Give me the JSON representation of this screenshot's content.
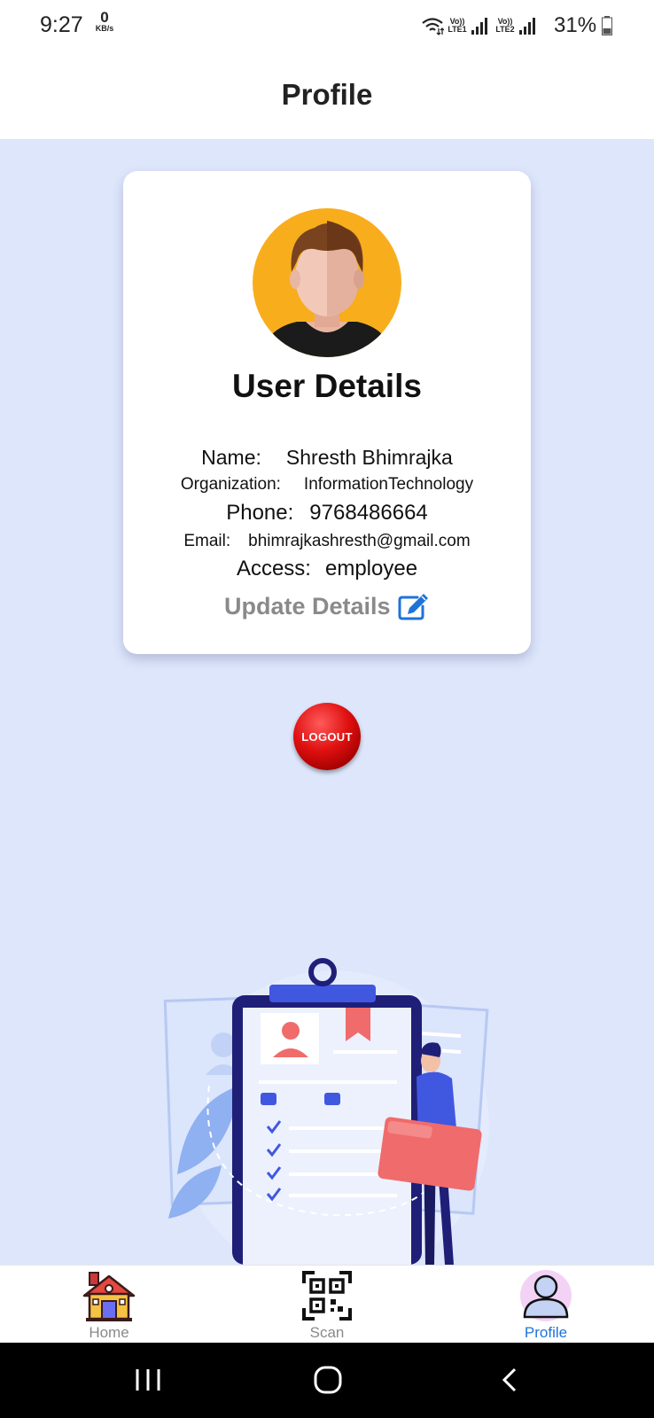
{
  "status_bar": {
    "time": "9:27",
    "net_speed_value": "0",
    "net_speed_unit": "KB/s",
    "sim1_label": "Vo)) LTE1",
    "sim2_label": "Vo)) LTE2",
    "battery_percent": "31%"
  },
  "header": {
    "title": "Profile"
  },
  "user_card": {
    "heading": "User Details",
    "name_label": "Name:",
    "name_value": "Shresth Bhimrajka",
    "organization_label": "Organization:",
    "organization_value": "InformationTechnology",
    "phone_label": "Phone:",
    "phone_value": "9768486664",
    "email_label": "Email:",
    "email_value": "bhimrajkashresth@gmail.com",
    "access_label": "Access:",
    "access_value": "employee",
    "update_label": "Update Details"
  },
  "logout": {
    "label": "LOGOUT"
  },
  "bottom_nav": {
    "items": [
      {
        "label": "Home",
        "icon": "home-icon",
        "active": false
      },
      {
        "label": "Scan",
        "icon": "qr-scan-icon",
        "active": false
      },
      {
        "label": "Profile",
        "icon": "profile-icon",
        "active": true
      }
    ],
    "active_color": "#1e73d8",
    "inactive_color": "#8a8a8a"
  },
  "system_nav": {
    "buttons": [
      "recent-apps-icon",
      "home-circle-icon",
      "back-icon"
    ]
  },
  "colors": {
    "background": "#dde6fb",
    "card": "#ffffff",
    "logout": "#e01010",
    "edit_icon": "#1e73d8"
  }
}
